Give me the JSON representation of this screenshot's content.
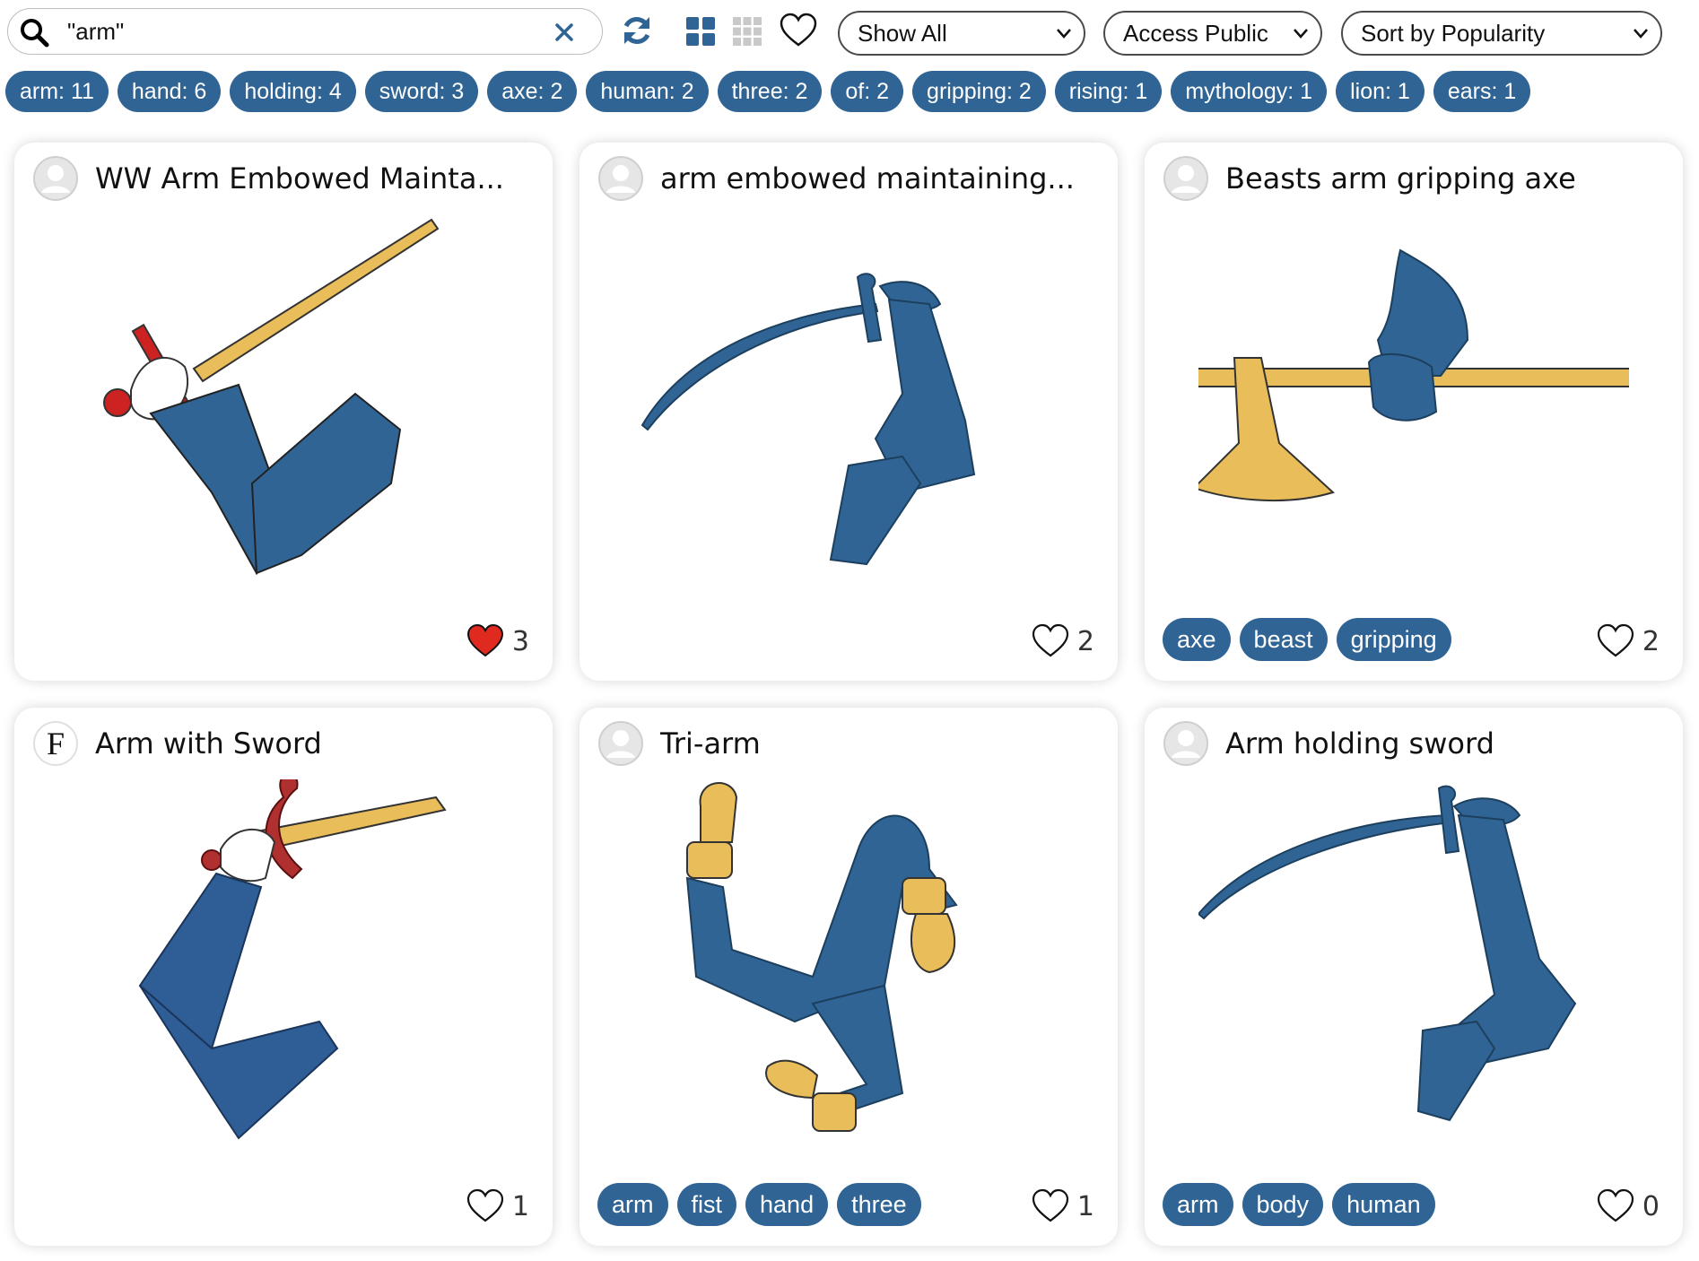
{
  "search": {
    "value": "\"arm\"",
    "placeholder": ""
  },
  "toolbar": {
    "icons": [
      "search-icon",
      "clear-icon",
      "refresh-icon",
      "grid-large-icon",
      "grid-small-icon",
      "heart-outline-icon"
    ],
    "show_filter": "Show All",
    "access_filter": "Access Public",
    "sort": "Sort by Popularity"
  },
  "tag_counts": [
    {
      "label": "arm: 11"
    },
    {
      "label": "hand: 6"
    },
    {
      "label": "holding: 4"
    },
    {
      "label": "sword: 3"
    },
    {
      "label": "axe: 2"
    },
    {
      "label": "human: 2"
    },
    {
      "label": "three: 2"
    },
    {
      "label": "of: 2"
    },
    {
      "label": "gripping: 2"
    },
    {
      "label": "rising: 1"
    },
    {
      "label": "mythology: 1"
    },
    {
      "label": "lion: 1"
    },
    {
      "label": "ears: 1"
    }
  ],
  "colors": {
    "accent": "#2f6494",
    "arm_blue": "#2f6494",
    "gold": "#e8bd5a",
    "red": "#cc2222",
    "liked": "#e12a1f"
  },
  "cards": [
    {
      "title": "WW Arm Embowed Mainta...",
      "avatar": "user-avatar-icon",
      "tags": [],
      "likes": "3",
      "liked": true
    },
    {
      "title": "arm embowed maintaining...",
      "avatar": "user-avatar-icon",
      "tags": [],
      "likes": "2",
      "liked": false
    },
    {
      "title": "Beasts arm gripping axe",
      "avatar": "user-avatar-icon",
      "tags": [
        "axe",
        "beast",
        "gripping"
      ],
      "likes": "2",
      "liked": false
    },
    {
      "title": "Arm with Sword",
      "avatar": "F",
      "tags": [],
      "likes": "1",
      "liked": false
    },
    {
      "title": "Tri-arm",
      "avatar": "user-avatar-icon",
      "tags": [
        "arm",
        "fist",
        "hand",
        "three"
      ],
      "likes": "1",
      "liked": false
    },
    {
      "title": "Arm holding sword",
      "avatar": "user-avatar-icon",
      "tags": [
        "arm",
        "body",
        "human"
      ],
      "likes": "0",
      "liked": false
    }
  ]
}
